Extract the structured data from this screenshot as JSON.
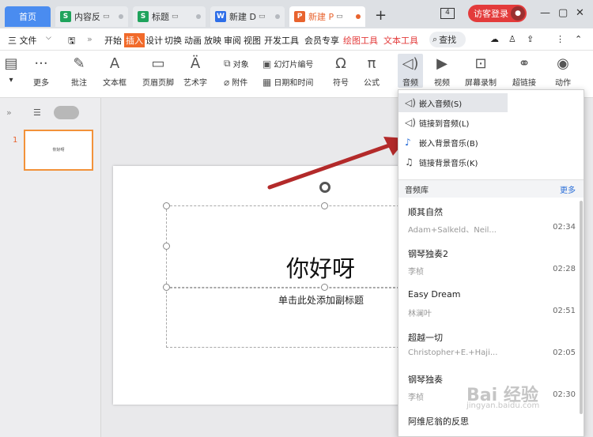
{
  "tabs": {
    "home": "首页",
    "t1": "内容反",
    "t2": "标题",
    "t3": "新建 D",
    "t4": "新建 P"
  },
  "window": {
    "count": "4",
    "login": "访客登录"
  },
  "menu": {
    "file": "三 文件",
    "items": [
      "开始",
      "插入",
      "设计",
      "切换",
      "动画",
      "放映",
      "审阅",
      "视图",
      "开发工具",
      "会员专享",
      "绘图工具",
      "文本工具"
    ],
    "search": "查找"
  },
  "ribbon": {
    "more": "更多",
    "annotate": "批注",
    "textbox": "文本框",
    "header_footer": "页眉页脚",
    "art_text": "艺术字",
    "object": "对象",
    "attachment": "附件",
    "slide_number": "幻灯片编号",
    "date_time": "日期和时间",
    "symbol": "符号",
    "formula": "公式",
    "audio": "音频",
    "video": "视频",
    "screen_record": "屏幕录制",
    "hyperlink": "超链接",
    "action": "动作"
  },
  "slides": {
    "thumb_text": "你好呀",
    "number": "1"
  },
  "slide": {
    "title": "你好呀",
    "subtitle": "单击此处添加副标题"
  },
  "audio_menu": {
    "items": [
      "嵌入音频(S)",
      "链接到音频(L)",
      "嵌入背景音乐(B)",
      "链接背景音乐(K)"
    ],
    "library_label": "音频库",
    "more": "更多",
    "songs": [
      {
        "name": "顺其自然",
        "artist": "Adam+Salkeld、Neil...",
        "duration": "02:34"
      },
      {
        "name": "钢琴独奏2",
        "artist": "李桢",
        "duration": "02:28"
      },
      {
        "name": "Easy Dream",
        "artist": "林澜叶",
        "duration": "02:51"
      },
      {
        "name": "超越一切",
        "artist": "Christopher+E.+Haji...",
        "duration": "02:05"
      },
      {
        "name": "钢琴独奏",
        "artist": "李桢",
        "duration": "02:30"
      },
      {
        "name": "阿维尼翁的反思",
        "artist": "",
        "duration": ""
      }
    ]
  },
  "watermark": {
    "main": "Bai 经验",
    "sub": "jingyan.baidu.com"
  },
  "colors": {
    "accent": "#f16a2a",
    "home_tab": "#4a8cf0",
    "login": "#e33b3b",
    "link": "#2b6fd8",
    "arrow": "#b32a2a"
  }
}
